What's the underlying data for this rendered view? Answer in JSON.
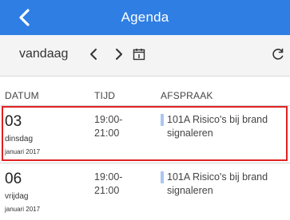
{
  "header": {
    "title": "Agenda",
    "back_icon": "chevron-left-icon"
  },
  "toolbar": {
    "today_label": "vandaag",
    "prev_symbol": "<",
    "next_symbol": ">",
    "calendar_icon": "calendar-icon",
    "refresh_icon": "refresh-icon"
  },
  "columns": {
    "date": "DATUM",
    "time": "TIJD",
    "appointment": "AFSPRAAK"
  },
  "rows": [
    {
      "day": "03",
      "weekday": "dinsdag",
      "month": "januari 2017",
      "time_start": "19:00-",
      "time_end": "21:00",
      "appointment_line1": "101A Risico's bij brand",
      "appointment_line2": "signaleren",
      "selected": true
    },
    {
      "day": "06",
      "weekday": "vrijdag",
      "month": "januari 2017",
      "time_start": "19:00-",
      "time_end": "21:00",
      "appointment_line1": "101A Risico's bij brand",
      "appointment_line2": "signaleren",
      "selected": false
    }
  ],
  "colors": {
    "header_bg": "#2f7ee3",
    "toolbar_bg": "#f4f4f5",
    "selection_border": "#e02121",
    "appointment_bar": "#a9c7f2"
  }
}
